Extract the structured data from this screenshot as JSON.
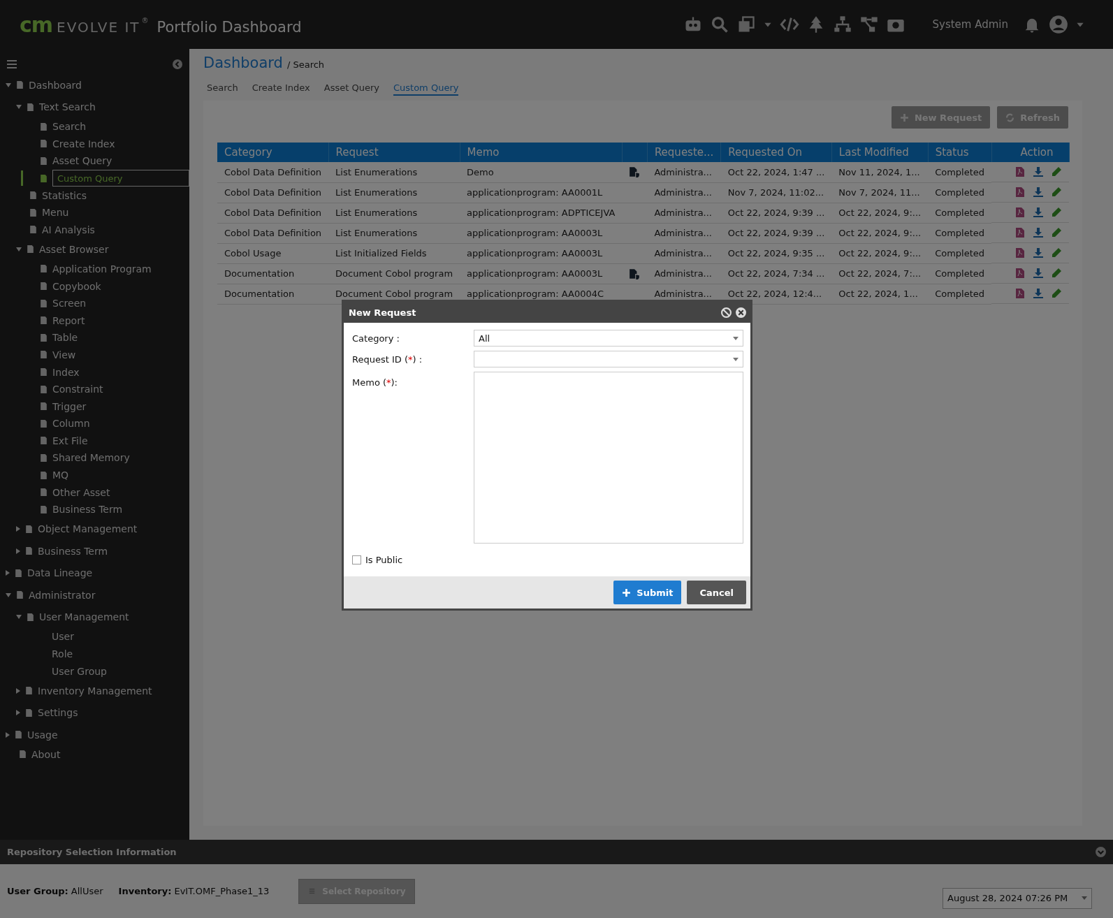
{
  "header": {
    "logo_mark": "cm",
    "logo_text": "EVOLVE IT",
    "logo_reg": "®",
    "title": "Portfolio Dashboard",
    "user": "System Admin"
  },
  "sidebar": {
    "items": [
      {
        "label": "Dashboard",
        "expanded": true,
        "selected": false,
        "children": [
          {
            "label": "Text Search",
            "expanded": true,
            "selected": false,
            "children": [
              {
                "label": "Search",
                "selected": false
              },
              {
                "label": "Create Index",
                "selected": false
              },
              {
                "label": "Asset Query",
                "selected": false
              },
              {
                "label": "Custom Query",
                "selected": true
              }
            ]
          },
          {
            "label": "Statistics",
            "selected": false
          },
          {
            "label": "Menu",
            "selected": false
          },
          {
            "label": "AI Analysis",
            "selected": false
          },
          {
            "label": "Asset Browser",
            "expanded": true,
            "selected": false,
            "children": [
              {
                "label": "Application Program",
                "selected": false
              },
              {
                "label": "Copybook",
                "selected": false
              },
              {
                "label": "Screen",
                "selected": false
              },
              {
                "label": "Report",
                "selected": false
              },
              {
                "label": "Table",
                "selected": false
              },
              {
                "label": "View",
                "selected": false
              },
              {
                "label": "Index",
                "selected": false
              },
              {
                "label": "Constraint",
                "selected": false
              },
              {
                "label": "Trigger",
                "selected": false
              },
              {
                "label": "Column",
                "selected": false
              },
              {
                "label": "Ext File",
                "selected": false
              },
              {
                "label": "Shared Memory",
                "selected": false
              },
              {
                "label": "MQ",
                "selected": false
              },
              {
                "label": "Other Asset",
                "selected": false
              },
              {
                "label": "Business Term",
                "selected": false
              }
            ]
          },
          {
            "label": "Object Management",
            "expanded": false,
            "selected": false
          },
          {
            "label": "Business Term",
            "expanded": false,
            "selected": false
          }
        ]
      },
      {
        "label": "Data Lineage",
        "expanded": false,
        "selected": false
      },
      {
        "label": "Administrator",
        "expanded": true,
        "selected": false,
        "children": [
          {
            "label": "User Management",
            "expanded": true,
            "selected": false,
            "children": [
              {
                "label": "User",
                "selected": false,
                "icon": false
              },
              {
                "label": "Role",
                "selected": false,
                "icon": false
              },
              {
                "label": "User Group",
                "selected": false,
                "icon": false
              }
            ]
          },
          {
            "label": "Inventory Management",
            "expanded": false,
            "selected": false
          },
          {
            "label": "Settings",
            "expanded": false,
            "selected": false
          }
        ]
      },
      {
        "label": "Usage",
        "expanded": false,
        "selected": false
      },
      {
        "label": "About",
        "selected": false
      }
    ]
  },
  "breadcrumb": {
    "root": "Dashboard",
    "current": "/ Search"
  },
  "tabs": [
    {
      "label": "Search",
      "selected": false
    },
    {
      "label": "Create Index",
      "selected": false
    },
    {
      "label": "Asset Query",
      "selected": false
    },
    {
      "label": "Custom Query",
      "selected": true
    }
  ],
  "toolbar": {
    "buttons": [
      "New Request",
      "Refresh"
    ]
  },
  "table": {
    "columns": [
      "Category",
      "Request",
      "Memo",
      "",
      "Requeste...",
      "Requested On",
      "Last Modified",
      "Status",
      "Action"
    ],
    "rows": [
      {
        "category": "Cobol Data Definition",
        "request": "List Enumerations",
        "memo": "Demo",
        "attachment": true,
        "requested_by": "Administra...",
        "requested_on": "Oct 22, 2024, 1:47 ...",
        "last_modified": "Nov 11, 2024, 1...",
        "status": "Completed"
      },
      {
        "category": "Cobol Data Definition",
        "request": "List Enumerations",
        "memo": "applicationprogram: AA0001L",
        "attachment": false,
        "requested_by": "Administra...",
        "requested_on": "Nov 7, 2024, 11:02...",
        "last_modified": "Nov 7, 2024, 11...",
        "status": "Completed"
      },
      {
        "category": "Cobol Data Definition",
        "request": "List Enumerations",
        "memo": "applicationprogram: ADPTICEJVA",
        "attachment": false,
        "requested_by": "Administra...",
        "requested_on": "Oct 22, 2024, 9:39 ...",
        "last_modified": "Oct 22, 2024, 9:...",
        "status": "Completed"
      },
      {
        "category": "Cobol Data Definition",
        "request": "List Enumerations",
        "memo": "applicationprogram: AA0003L",
        "attachment": false,
        "requested_by": "Administra...",
        "requested_on": "Oct 22, 2024, 9:39 ...",
        "last_modified": "Oct 22, 2024, 9:...",
        "status": "Completed"
      },
      {
        "category": "Cobol Usage",
        "request": "List Initialized Fields",
        "memo": "applicationprogram: AA0003L",
        "attachment": false,
        "requested_by": "Administra...",
        "requested_on": "Oct 22, 2024, 9:35 ...",
        "last_modified": "Oct 22, 2024, 9:...",
        "status": "Completed"
      },
      {
        "category": "Documentation",
        "request": "Document Cobol program",
        "memo": "applicationprogram: AA0003L",
        "attachment": true,
        "requested_by": "Administra...",
        "requested_on": "Oct 22, 2024, 7:34 ...",
        "last_modified": "Oct 22, 2024, 7:...",
        "status": "Completed"
      },
      {
        "category": "Documentation",
        "request": "Document Cobol program",
        "memo": "applicationprogram: AA0004C",
        "attachment": false,
        "requested_by": "Administra...",
        "requested_on": "Oct 22, 2024, 12:4...",
        "last_modified": "Oct 22, 2024, 1...",
        "status": "Completed"
      }
    ]
  },
  "dialog": {
    "title": "New Request",
    "fields": [
      {
        "kind": "select",
        "label": "Category",
        "suffix": " :",
        "value": "All"
      },
      {
        "kind": "select",
        "label": "Request ID (",
        "required": "*",
        "suffix": ") :"
      },
      {
        "kind": "textarea",
        "label": "Memo (",
        "required": "*",
        "suffix": "):"
      }
    ],
    "is_public": {
      "label": "Is Public",
      "checked": false
    },
    "buttons": [
      {
        "label": "Submit",
        "kind": "primary"
      },
      {
        "label": "Cancel",
        "kind": "secondary"
      }
    ]
  },
  "footer": {
    "title": "Repository Selection Information",
    "user_group_label": "User Group:",
    "user_group": "AllUser",
    "inventory_label": "Inventory:",
    "inventory": "EvIT.OMF_Phase1_13",
    "select_button": "Select Repository",
    "date": "August 28, 2024 07:26 PM"
  }
}
